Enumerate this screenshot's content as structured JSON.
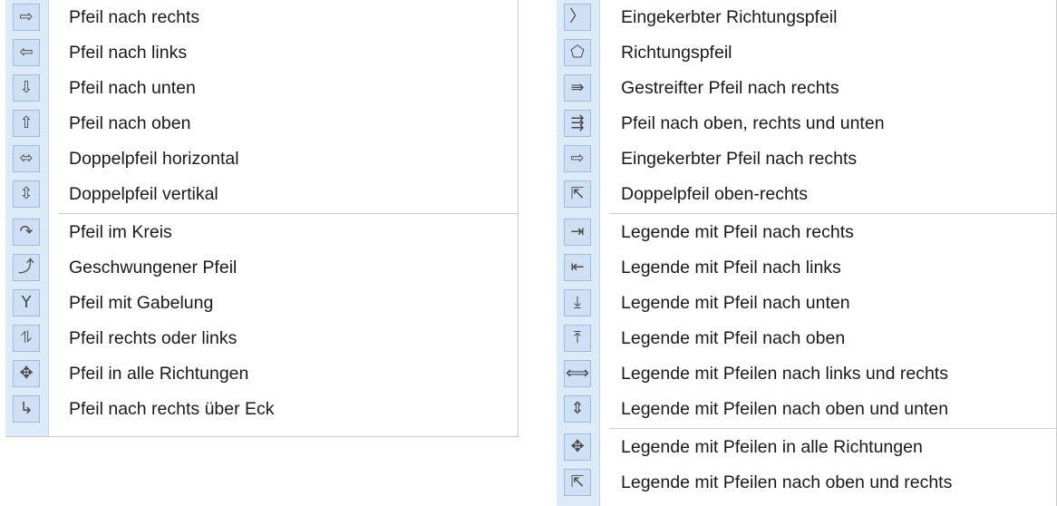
{
  "left_menu": {
    "group1": [
      {
        "label": "Pfeil nach rechts",
        "icon": "right-arrow-icon",
        "glyph": "⇨"
      },
      {
        "label": "Pfeil nach links",
        "icon": "left-arrow-icon",
        "glyph": "⇦"
      },
      {
        "label": "Pfeil nach unten",
        "icon": "down-arrow-icon",
        "glyph": "⇩"
      },
      {
        "label": "Pfeil nach oben",
        "icon": "up-arrow-icon",
        "glyph": "⇧"
      },
      {
        "label": "Doppelpfeil horizontal",
        "icon": "left-right-arrow-icon",
        "glyph": "⬄"
      },
      {
        "label": "Doppelpfeil vertikal",
        "icon": "up-down-arrow-icon",
        "glyph": "⇳"
      }
    ],
    "group2": [
      {
        "label": "Pfeil im Kreis",
        "icon": "circular-arrow-icon",
        "glyph": "↷"
      },
      {
        "label": "Geschwungener Pfeil",
        "icon": "curved-arrow-icon",
        "glyph": "⤴"
      },
      {
        "label": "Pfeil mit Gabelung",
        "icon": "split-arrow-icon",
        "glyph": "Y"
      },
      {
        "label": "Pfeil rechts oder links",
        "icon": "right-or-left-arrow-icon",
        "glyph": "⥮"
      },
      {
        "label": "Pfeil in alle Richtungen",
        "icon": "four-way-arrow-icon",
        "glyph": "✥"
      },
      {
        "label": "Pfeil nach rechts über Eck",
        "icon": "corner-right-arrow-icon",
        "glyph": "↳"
      }
    ]
  },
  "right_menu": {
    "group1": [
      {
        "label": "Eingekerbter Richtungspfeil",
        "icon": "chevron-icon",
        "glyph": "〉"
      },
      {
        "label": "Richtungspfeil",
        "icon": "pentagon-icon",
        "glyph": "⬠"
      },
      {
        "label": "Gestreifter Pfeil nach rechts",
        "icon": "striped-right-arrow-icon",
        "glyph": "⇛"
      },
      {
        "label": "Pfeil nach oben, rechts und unten",
        "icon": "up-right-down-arrow-icon",
        "glyph": "⇶"
      },
      {
        "label": "Eingekerbter Pfeil nach rechts",
        "icon": "notched-right-arrow-icon",
        "glyph": "⇨"
      },
      {
        "label": "Doppelpfeil oben-rechts",
        "icon": "up-right-double-arrow-icon",
        "glyph": "⇱"
      }
    ],
    "group2": [
      {
        "label": "Legende mit Pfeil nach rechts",
        "icon": "callout-right-arrow-icon",
        "glyph": "⇥"
      },
      {
        "label": "Legende mit Pfeil nach links",
        "icon": "callout-left-arrow-icon",
        "glyph": "⇤"
      },
      {
        "label": "Legende mit Pfeil nach unten",
        "icon": "callout-down-arrow-icon",
        "glyph": "⤓"
      },
      {
        "label": "Legende mit Pfeil nach oben",
        "icon": "callout-up-arrow-icon",
        "glyph": "⤒"
      },
      {
        "label": "Legende mit Pfeilen nach links und rechts",
        "icon": "callout-left-right-arrows-icon",
        "glyph": "⟺"
      },
      {
        "label": "Legende mit Pfeilen nach oben und unten",
        "icon": "callout-up-down-arrows-icon",
        "glyph": "⇕"
      }
    ],
    "group3": [
      {
        "label": "Legende mit Pfeilen in alle Richtungen",
        "icon": "callout-four-way-arrows-icon",
        "glyph": "✥"
      },
      {
        "label": "Legende mit Pfeilen nach oben und rechts",
        "icon": "callout-up-right-arrows-icon",
        "glyph": "⇱"
      }
    ]
  }
}
